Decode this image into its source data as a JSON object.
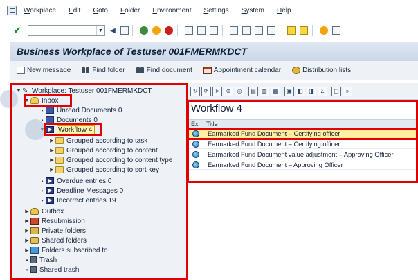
{
  "menu": {
    "items": [
      "Workplace",
      "Edit",
      "Goto",
      "Folder",
      "Environment",
      "Settings",
      "System",
      "Help"
    ]
  },
  "title": "Business Workplace of Testuser 001FMERMKDCT",
  "app_toolbar": {
    "new_message": "New message",
    "find_folder": "Find folder",
    "find_document": "Find document",
    "appointment_calendar": "Appointment calendar",
    "distribution_lists": "Distribution lists"
  },
  "tree": {
    "root": "Workplace: Testuser 001FMERMKDCT",
    "inbox": "Inbox",
    "unread": "Unread Documents 0",
    "documents": "Documents 0",
    "workflow": "Workflow 4",
    "grouped_task": "Grouped according to task",
    "grouped_content": "Grouped according to content",
    "grouped_content_type": "Grouped according to content type",
    "grouped_sort_key": "Grouped according to sort key",
    "overdue": "Overdue entries 0",
    "deadline": "Deadline Messages 0",
    "incorrect": "Incorrect entries 19",
    "outbox": "Outbox",
    "resubmission": "Resubmission",
    "private": "Private folders",
    "shared": "Shared folders",
    "subscribed": "Folders subscribed to",
    "trash": "Trash",
    "shared_trash": "Shared trash"
  },
  "workflow_panel": {
    "heading": "Workflow 4",
    "col_ex": "Ex",
    "col_title": "Title",
    "rows": [
      "Earmarked Fund Document – Certifying officer",
      "Earmarked Fund Document – Certifying officer",
      "Earmarked Fund  Document value adjustment – Approving Officer",
      "Earmarked Fund Document – Approving Officer"
    ],
    "selected_row": 0
  },
  "colors": {
    "highlight_box": "#e00000",
    "selection": "#fff0a0",
    "panel_bg": "#eef2f7"
  }
}
